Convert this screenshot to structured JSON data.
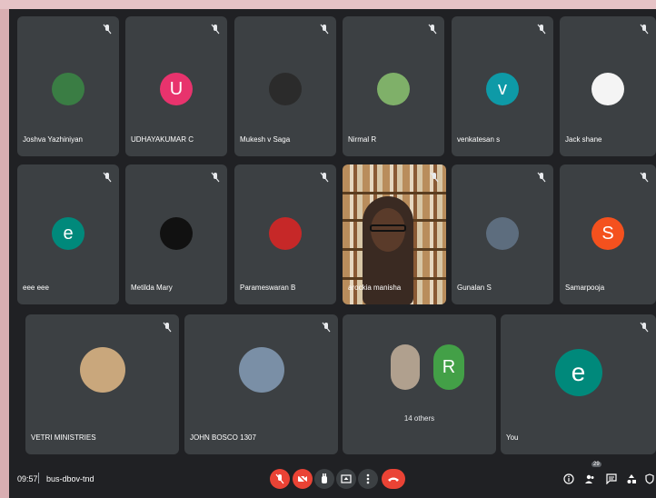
{
  "tiles": [
    {
      "name": "Joshva Yazhiniyan",
      "avatar": "photo",
      "color": "#3a7d44"
    },
    {
      "name": "UDHAYAKUMAR C",
      "avatar": "letter",
      "letter": "U",
      "color": "#e8336d"
    },
    {
      "name": "Mukesh v Saga",
      "avatar": "photo",
      "color": "#2b2b2b"
    },
    {
      "name": "Nirmal R",
      "avatar": "photo",
      "color": "#7fb069"
    },
    {
      "name": "venkatesan s",
      "avatar": "letter",
      "letter": "v",
      "color": "#0e9aa7"
    },
    {
      "name": "Jack shane",
      "avatar": "photo",
      "color": "#f4f4f4"
    },
    {
      "name": "eee eee",
      "avatar": "letter",
      "letter": "e",
      "color": "#00897b"
    },
    {
      "name": "Metilda Mary",
      "avatar": "photo",
      "color": "#111111"
    },
    {
      "name": "Parameswaran B",
      "avatar": "photo",
      "color": "#c62828"
    },
    {
      "name": "arockia manisha",
      "avatar": "video"
    },
    {
      "name": "Gunalan S",
      "avatar": "photo",
      "color": "#5d6d7e"
    },
    {
      "name": "Samarpooja",
      "avatar": "letter",
      "letter": "S",
      "color": "#f4511e"
    },
    {
      "name": "VETRI MINISTRIES",
      "avatar": "photo",
      "color": "#c9a77c"
    },
    {
      "name": "JOHN BOSCO 1307",
      "avatar": "photo",
      "color": "#7a8fa6"
    },
    {
      "name": "",
      "avatar": "group",
      "others": "14 others",
      "letter": "R",
      "color": "#43a047"
    },
    {
      "name": "You",
      "avatar": "letter",
      "letter": "e",
      "color": "#00897b"
    }
  ],
  "bottom_bar": {
    "time": "09:57",
    "meeting_code": "bus-dbov-tnd",
    "participant_count": "29"
  },
  "colors": {
    "background": "#202124",
    "tile": "#3c4043",
    "danger": "#ea4335"
  }
}
